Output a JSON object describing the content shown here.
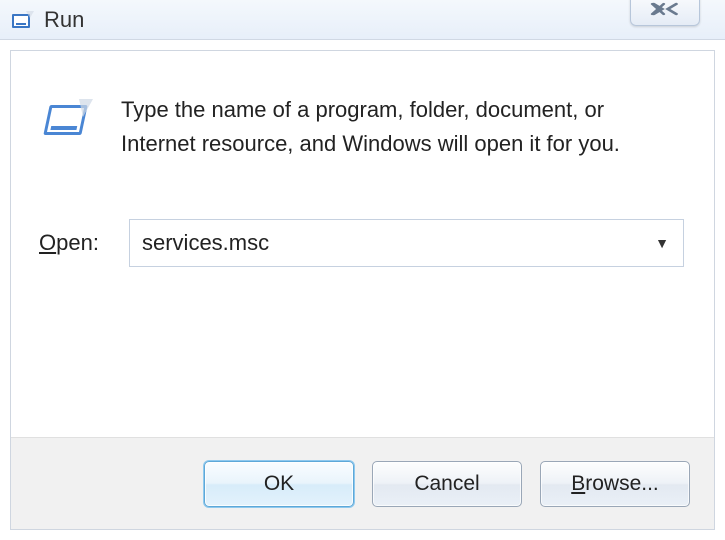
{
  "titlebar": {
    "title": "Run"
  },
  "close": {
    "glyph": "✕"
  },
  "description": "Type the name of a program, folder, document, or Internet resource, and Windows will open it for you.",
  "open": {
    "label_pre_underline": "",
    "label_underline": "O",
    "label_post_underline": "pen:"
  },
  "input": {
    "value": "services.msc"
  },
  "buttons": {
    "ok": "OK",
    "cancel": "Cancel",
    "browse_underline": "B",
    "browse_rest": "rowse..."
  }
}
